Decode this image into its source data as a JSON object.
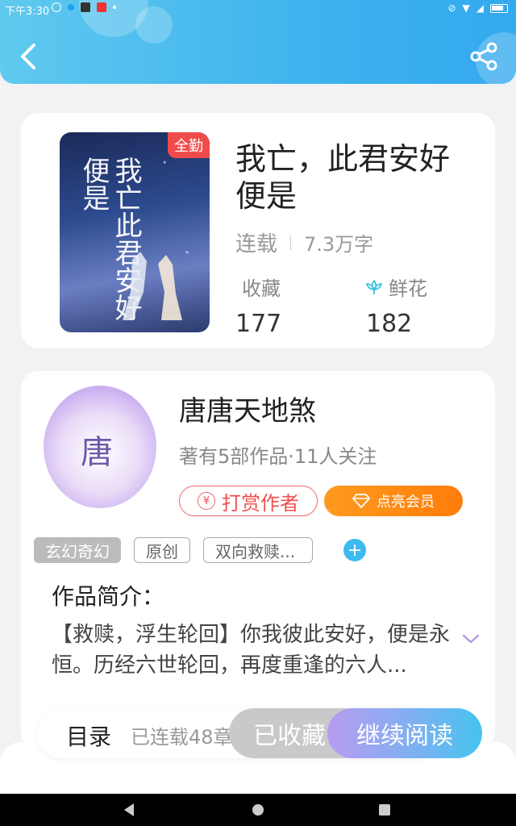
{
  "status_bar": {
    "time": "下午3:30"
  },
  "book": {
    "cover_title": "我亡此君安好便是",
    "badge": "全勤",
    "title": "我亡，此君安好便是",
    "status": "连载",
    "word_count": "7.3万字",
    "favorites_label": "收藏",
    "favorites_count": "177",
    "flowers_label": "鲜花",
    "flowers_count": "182"
  },
  "author": {
    "avatar_char": "唐",
    "name": "唐唐天地煞",
    "info": "著有5部作品·11人关注",
    "tip_label": "打赏作者",
    "vip_label": "点亮会员"
  },
  "tags": [
    "玄幻奇幻",
    "原创",
    "双向救赎..."
  ],
  "intro": {
    "heading": "作品简介：",
    "text": "【救赎，浮生轮回】你我彼此安好，便是永恒。历经六世轮回，再度重逢的六人..."
  },
  "bottom": {
    "toc_label": "目录",
    "toc_count": "已连载48章",
    "fav_button": "已收藏",
    "read_button": "继续阅读"
  },
  "colors": {
    "header": "#3fb3ee",
    "accent_red": "#f05050",
    "vip_orange": "#ff8a12",
    "tag_add": "#3dbaf0"
  }
}
